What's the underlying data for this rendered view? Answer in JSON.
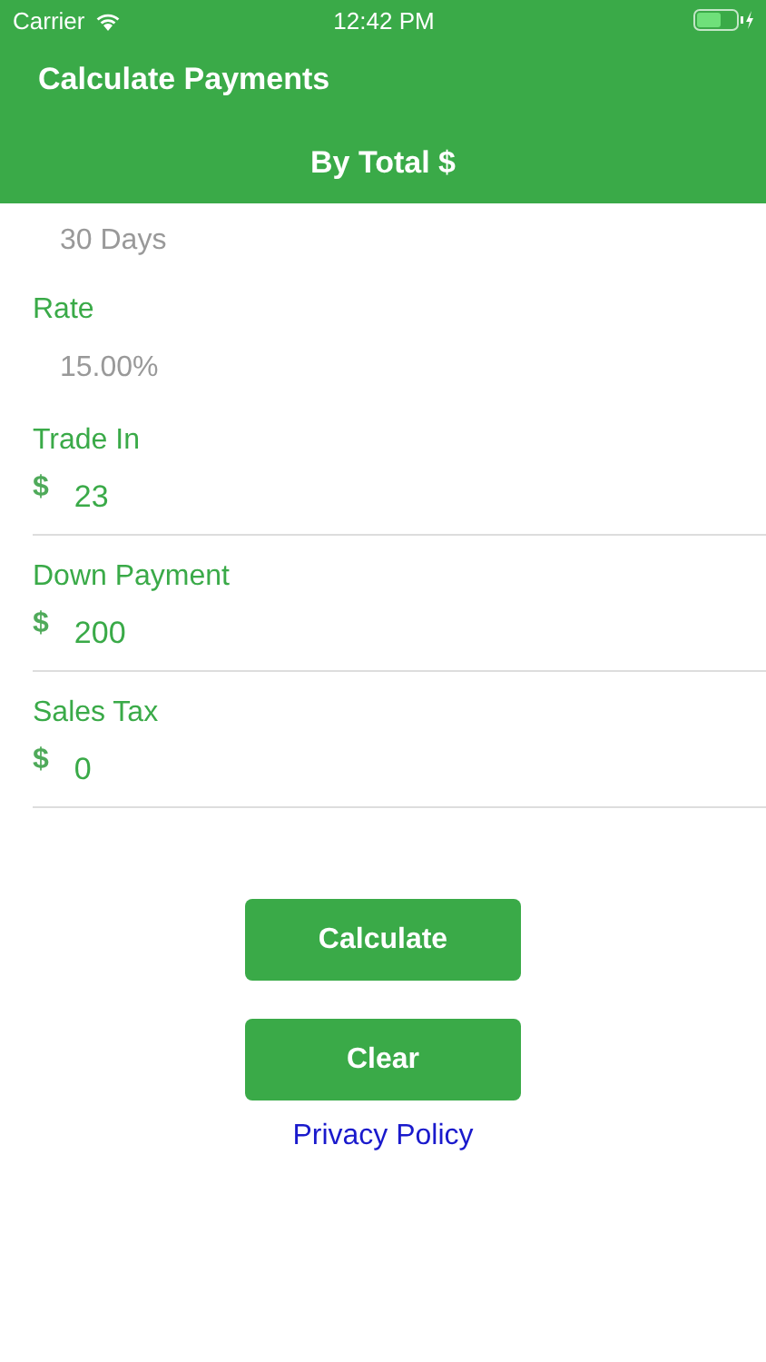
{
  "status_bar": {
    "carrier": "Carrier",
    "time": "12:42 PM"
  },
  "nav": {
    "title": "Calculate Payments",
    "subtitle": "By Total $"
  },
  "fields": [
    {
      "kind": "plain",
      "value": "30 Days"
    },
    {
      "kind": "plain",
      "label": "Rate",
      "value": "15.00%"
    },
    {
      "kind": "currency",
      "label": "Trade In",
      "prefix": "$",
      "value": "23"
    },
    {
      "kind": "currency",
      "label": "Down Payment",
      "prefix": "$",
      "value": "200"
    },
    {
      "kind": "currency",
      "label": "Sales Tax",
      "prefix": "$",
      "value": "0"
    }
  ],
  "buttons": [
    "Calculate",
    "Clear"
  ],
  "link": "Privacy Policy"
}
